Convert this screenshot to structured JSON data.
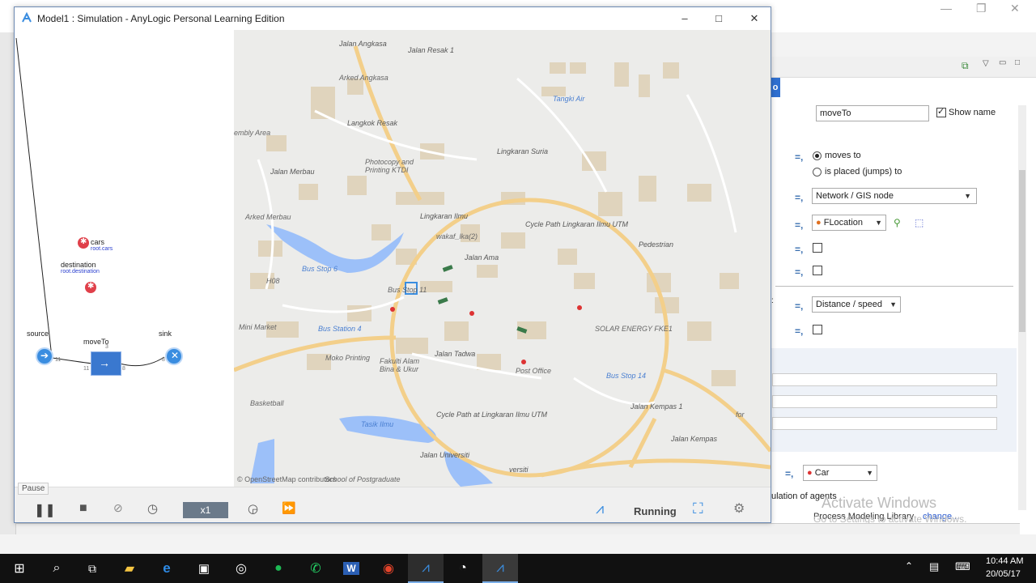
{
  "simulation_window": {
    "title": "Model1 : Simulation - AnyLogic Personal Learning Edition",
    "controls": {
      "minimize": "–",
      "maximize": "□",
      "close": "✕"
    }
  },
  "model_blocks": {
    "cars": {
      "label": "cars",
      "sub": "root.cars"
    },
    "destination": {
      "label": "destination",
      "sub": "root.destination"
    },
    "source": {
      "label": "source",
      "count": "11"
    },
    "moveTo": {
      "label": "moveTo",
      "in": "11",
      "out": "8",
      "top": "3"
    },
    "sink": {
      "label": "sink",
      "count": "8"
    }
  },
  "map": {
    "attribution": "© OpenStreetMap contributors",
    "labels": [
      {
        "id": "jalan-angkasa",
        "text": "Jalan Angkasa"
      },
      {
        "id": "arked-angkasa",
        "text": "Arked Angkasa"
      },
      {
        "id": "jalan-resak",
        "text": "Jalan Resak 1"
      },
      {
        "id": "tangki-air",
        "text": "Tangki Air"
      },
      {
        "id": "assembly",
        "text": "embly Area"
      },
      {
        "id": "langkok-resak",
        "text": "Langkok Resak"
      },
      {
        "id": "photocopy",
        "text": "Photocopy and Printing KTDI"
      },
      {
        "id": "lingkaran-suria",
        "text": "Lingkaran Suria"
      },
      {
        "id": "jalan-merbau",
        "text": "Jalan Merbau"
      },
      {
        "id": "arked-merbau",
        "text": "Arked Merbau"
      },
      {
        "id": "lingkaran-ilmu",
        "text": "Lingkaran Ilmu"
      },
      {
        "id": "cycle-path-1",
        "text": "Cycle Path Lingkaran Ilmu UTM"
      },
      {
        "id": "wakaf",
        "text": "wakaf_lka(2)"
      },
      {
        "id": "jalan-ama",
        "text": "Jalan Ama"
      },
      {
        "id": "pedestrian",
        "text": "Pedestrian"
      },
      {
        "id": "bus-stop-6",
        "text": "Bus Stop 6"
      },
      {
        "id": "h08",
        "text": "H08"
      },
      {
        "id": "bus-stop-11",
        "text": "Bus Stop 11"
      },
      {
        "id": "mini-market",
        "text": "Mini Market"
      },
      {
        "id": "bus-station-4",
        "text": "Bus Station 4"
      },
      {
        "id": "solar",
        "text": "SOLAR ENERGY FKE1"
      },
      {
        "id": "jalan-tadwa",
        "text": "Jalan Tadwa"
      },
      {
        "id": "moko",
        "text": "Moko Printing"
      },
      {
        "id": "fakulti",
        "text": "Fakulti Alam Bina & Ukur"
      },
      {
        "id": "post-office",
        "text": "Post Office"
      },
      {
        "id": "bus-stop-14",
        "text": "Bus Stop 14"
      },
      {
        "id": "basketball",
        "text": "Basketball"
      },
      {
        "id": "cycle-path-2",
        "text": "Cycle Path at Lingkaran Ilmu UTM"
      },
      {
        "id": "tasik-ilmu",
        "text": "Tasik Ilmu"
      },
      {
        "id": "jalan-universiti",
        "text": "Jalan Universiti"
      },
      {
        "id": "jalan-kempas-1",
        "text": "Jalan Kempas 1"
      },
      {
        "id": "jalan-kempas",
        "text": "Jalan Kempas"
      },
      {
        "id": "for",
        "text": "for"
      },
      {
        "id": "school",
        "text": "School of Postgraduate"
      },
      {
        "id": "versiti",
        "text": "versiti"
      }
    ]
  },
  "control_bar": {
    "tooltip": "Pause",
    "speed": "x1",
    "status": "Running"
  },
  "properties": {
    "name_value": "moveTo",
    "show_name_label": "Show name",
    "show_name_checked": true,
    "radio_moves_to": "moves to",
    "radio_placed": "is placed (jumps) to",
    "destination_type": "Network / GIS node",
    "location": "FLocation",
    "mode": "Distance / speed",
    "agent_type": "Car",
    "population_text": "ulation of agents",
    "tab_letter": "o"
  },
  "watermark": {
    "title": "Activate Windows",
    "subtitle": "Go to Settings to activate Windows."
  },
  "background_text": {
    "library": "Process Modeling Library",
    "change": "change..."
  },
  "taskbar": {
    "time": "10:44 AM",
    "date": "20/05/17"
  },
  "colors": {
    "map_road": "#f3cf8a",
    "map_building": "#e0d4bd",
    "map_water": "#9cc0f9",
    "anylogic_blue": "#3a8de0",
    "block_blue": "#3a78cf"
  }
}
